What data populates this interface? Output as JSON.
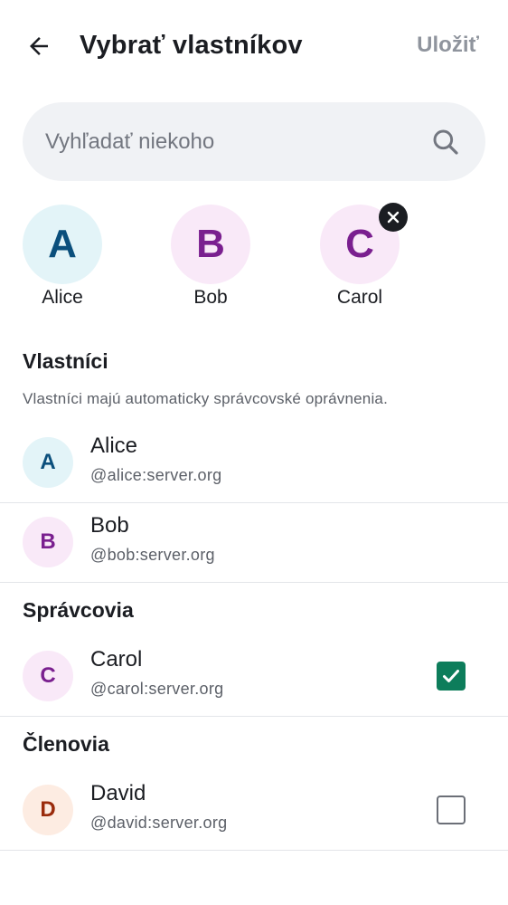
{
  "header": {
    "title": "Vybrať vlastníkov",
    "save_label": "Uložiť"
  },
  "search": {
    "placeholder": "Vyhľadať niekoho",
    "value": ""
  },
  "selected": [
    {
      "initial": "A",
      "name": "Alice",
      "removable": false
    },
    {
      "initial": "B",
      "name": "Bob",
      "removable": false
    },
    {
      "initial": "C",
      "name": "Carol",
      "removable": true
    }
  ],
  "sections": {
    "owners": {
      "title": "Vlastníci",
      "description": "Vlastníci majú automaticky správcovské oprávnenia.",
      "members": [
        {
          "initial": "A",
          "name": "Alice",
          "id": "@alice:server.org"
        },
        {
          "initial": "B",
          "name": "Bob",
          "id": "@bob:server.org"
        }
      ]
    },
    "admins": {
      "title": "Správcovia",
      "members": [
        {
          "initial": "C",
          "name": "Carol",
          "id": "@carol:server.org",
          "checked": true
        }
      ]
    },
    "members": {
      "title": "Členovia",
      "members": [
        {
          "initial": "D",
          "name": "David",
          "id": "@david:server.org",
          "checked": false
        }
      ]
    }
  },
  "colors": {
    "accent_check": "#0d7d5b",
    "alice_bg": "#e3f4f8",
    "alice_fg": "#0b4f7c",
    "bob_bg": "#f9e9f8",
    "bob_fg": "#7a1f8f",
    "carol_bg": "#f9e9f8",
    "carol_fg": "#7a1f8f",
    "david_bg": "#fdece2",
    "david_fg": "#9a2b0c"
  }
}
